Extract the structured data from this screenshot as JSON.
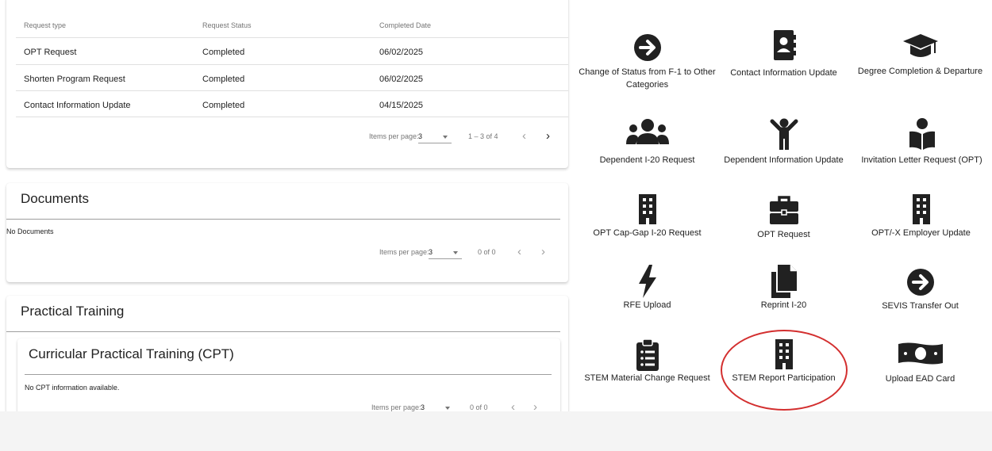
{
  "requests": {
    "headers": [
      "Request type",
      "Request Status",
      "Completed Date"
    ],
    "rows": [
      [
        "OPT Request",
        "Completed",
        "06/02/2025"
      ],
      [
        "Shorten Program Request",
        "Completed",
        "06/02/2025"
      ],
      [
        "Contact Information Update",
        "Completed",
        "04/15/2025"
      ]
    ],
    "pager": {
      "label": "Items per page:",
      "value": "3",
      "range": "1 – 3 of 4"
    }
  },
  "documents": {
    "title": "Documents",
    "empty": "No Documents",
    "pager": {
      "label": "Items per page:",
      "value": "3",
      "range": "0 of 0"
    }
  },
  "practical_training": {
    "title": "Practical Training",
    "cpt": {
      "title": "Curricular Practical Training (CPT)",
      "empty": "No CPT information available.",
      "pager": {
        "label": "Items per page:",
        "value": "3",
        "range": "0 of 0"
      }
    }
  },
  "actions": [
    {
      "label": "Change of Status from F-1 to Other Categories",
      "icon": "arrow-right-circle-icon"
    },
    {
      "label": "Contact Information Update",
      "icon": "contact-book-icon"
    },
    {
      "label": "Degree Completion & Departure",
      "icon": "graduation-cap-icon"
    },
    {
      "label": "Dependent I-20 Request",
      "icon": "group-icon"
    },
    {
      "label": "Dependent Information Update",
      "icon": "person-arms-up-icon"
    },
    {
      "label": "Invitation Letter Request (OPT)",
      "icon": "reader-book-icon"
    },
    {
      "label": "OPT Cap-Gap I-20 Request",
      "icon": "building-icon"
    },
    {
      "label": "OPT Request",
      "icon": "briefcase-icon"
    },
    {
      "label": "OPT/-X Employer Update",
      "icon": "building-icon"
    },
    {
      "label": "RFE Upload",
      "icon": "lightning-bolt-icon"
    },
    {
      "label": "Reprint I-20",
      "icon": "copy-documents-icon"
    },
    {
      "label": "SEVIS Transfer Out",
      "icon": "arrow-right-circle-icon"
    },
    {
      "label": "STEM Material Change Request",
      "icon": "clipboard-list-icon"
    },
    {
      "label": "STEM Report Participation",
      "icon": "building-icon"
    },
    {
      "label": "Upload EAD Card",
      "icon": "money-card-icon"
    }
  ],
  "colors": {
    "icon": "#212121",
    "highlight": "#d32f2f",
    "divider": "#9e9e9e",
    "footer": "#f4f4f4"
  }
}
